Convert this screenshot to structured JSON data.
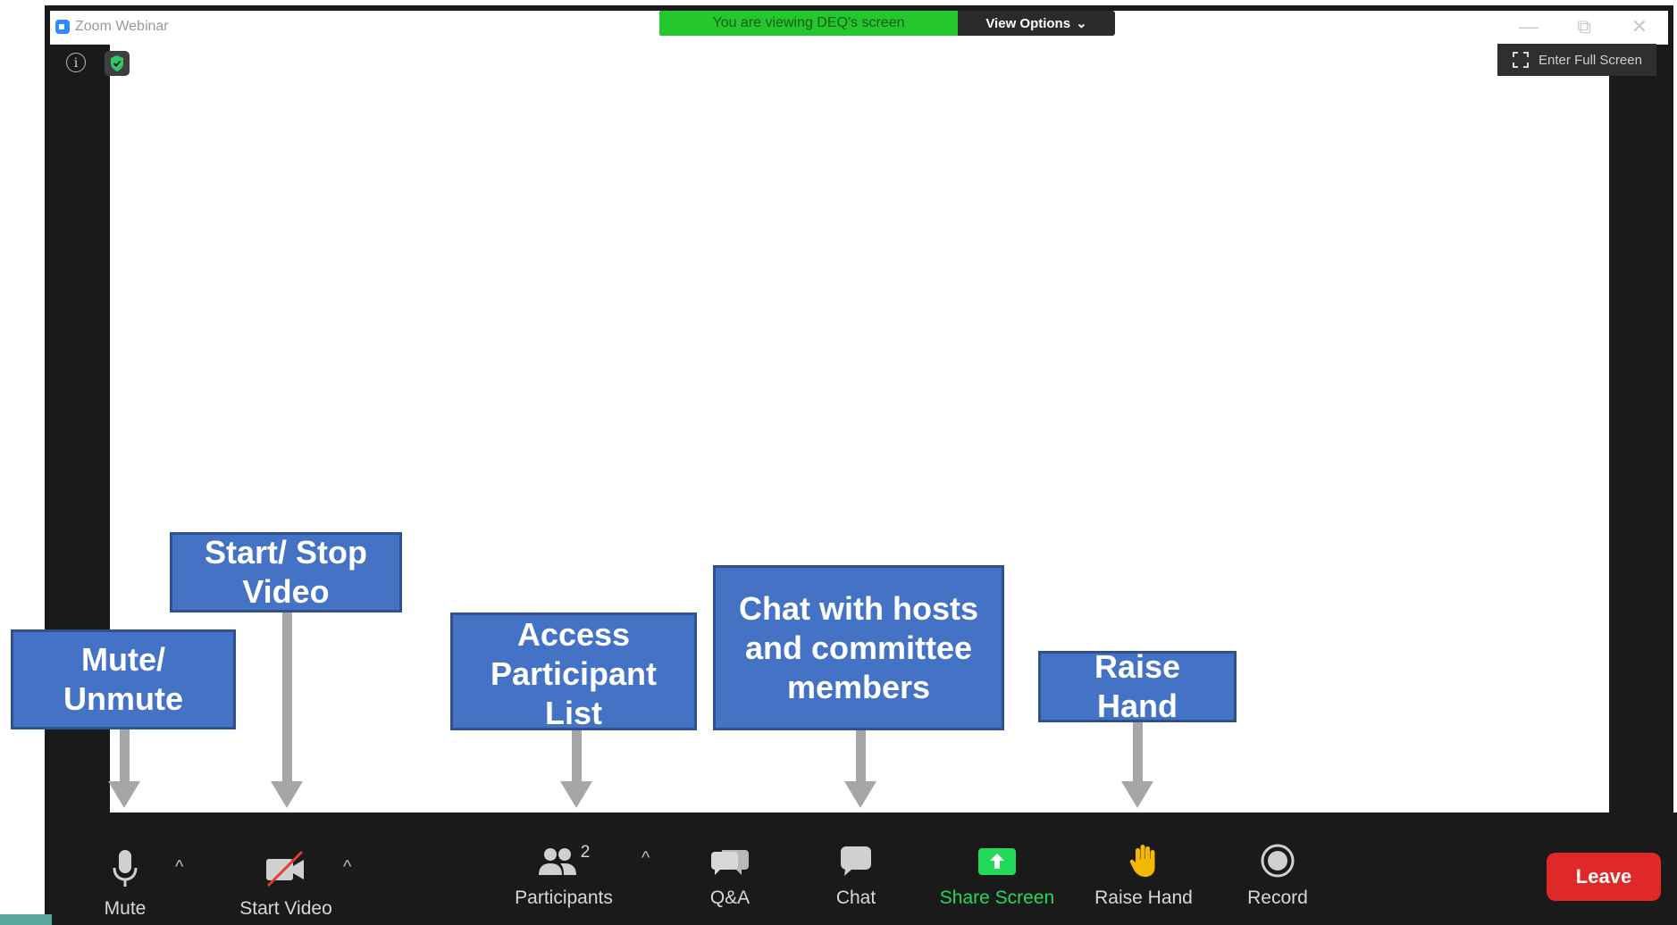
{
  "window": {
    "title": "Zoom Webinar",
    "controls": [
      "—",
      "⧉",
      "✕"
    ]
  },
  "banner": {
    "viewing_text": "You are viewing DEQ's screen",
    "view_options_label": "View Options",
    "view_options_caret": "⌄"
  },
  "top_left": {
    "info_symbol": "i"
  },
  "fullscreen": {
    "label": "Enter Full Screen",
    "icon": "expand-icon"
  },
  "toolbar": {
    "mute_label": "Mute",
    "start_video_label": "Start Video",
    "participants_label": "Participants",
    "participants_count": "2",
    "qa_label": "Q&A",
    "chat_label": "Chat",
    "share_screen_label": "Share Screen",
    "raise_hand_label": "Raise Hand",
    "record_label": "Record",
    "leave_label": "Leave",
    "caret": "^"
  },
  "callouts": {
    "mute": "Mute/\nUnmute",
    "video": "Start/ Stop\nVideo",
    "participants": "Access\nParticipant\nList",
    "chat": "Chat with hosts\nand committee\nmembers",
    "raise_hand": "Raise\nHand"
  },
  "colors": {
    "banner_green": "#24c72e",
    "share_screen_green": "#23d959",
    "leave_red": "#e02828",
    "callout_blue": "#4472c4",
    "arrow_gray": "#a6a6a6"
  }
}
